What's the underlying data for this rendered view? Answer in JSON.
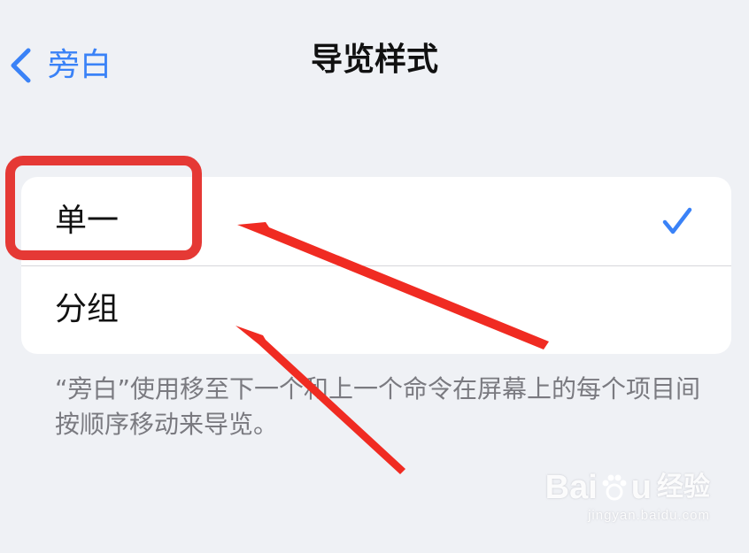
{
  "nav": {
    "back_label": "旁白",
    "title": "导览样式"
  },
  "options": [
    {
      "label": "单一",
      "selected": true
    },
    {
      "label": "分组",
      "selected": false
    }
  ],
  "footer_note": "“旁白”使用移至下一个和上一个命令在屏幕上的每个项目间按顺序移动来导览。",
  "colors": {
    "accent": "#3a82f7",
    "annotation": "#e53935",
    "background": "#eff1f5"
  },
  "icons": {
    "back": "chevron-left-icon",
    "selected": "checkmark-icon"
  },
  "watermark": {
    "logo_left": "Bai",
    "logo_right": "u",
    "tag": "经验",
    "url": "jingyan.baidu.com"
  }
}
